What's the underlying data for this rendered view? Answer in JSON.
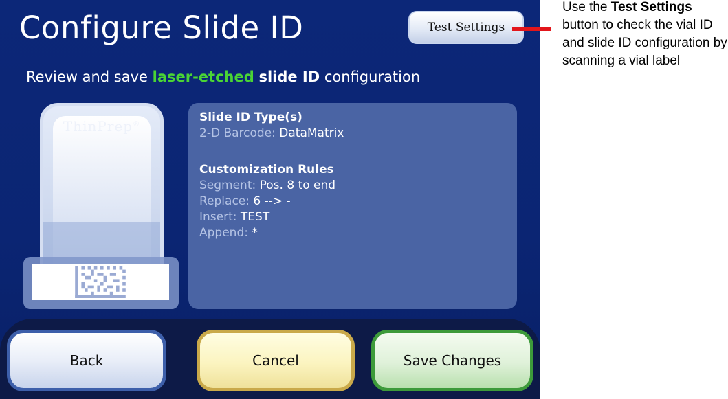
{
  "screen": {
    "title": "Configure Slide ID",
    "test_settings_label": "Test Settings",
    "subtitle": {
      "part1": "Review and save ",
      "highlight": "laser-etched",
      "part2": " ",
      "bold": "slide ID",
      "part3": " configuration"
    },
    "slide_brand": "ThinPrep",
    "slide_brand_mark": "®",
    "info": {
      "section1_heading": "Slide ID Type(s)",
      "section1_rows": [
        {
          "key": "2-D Barcode:",
          "value": "DataMatrix"
        }
      ],
      "section2_heading": "Customization Rules",
      "section2_rows": [
        {
          "key": "Segment:",
          "value": "Pos. 8 to end"
        },
        {
          "key": "Replace:",
          "value": "6 --> -"
        },
        {
          "key": "Insert:",
          "value": "TEST"
        },
        {
          "key": "Append:",
          "value": "*"
        }
      ]
    },
    "buttons": {
      "back": "Back",
      "cancel": "Cancel",
      "save": "Save Changes"
    }
  },
  "callout": {
    "part1": "Use the ",
    "bold": "Test Settings",
    "part2": " button to check the vial ID and slide ID configuration by scanning a vial label"
  },
  "colors": {
    "screen_bg": "#0b2573",
    "panel_bg": "#4a64a4",
    "highlight_green": "#4ad435",
    "arrow_red": "#e2161b"
  }
}
